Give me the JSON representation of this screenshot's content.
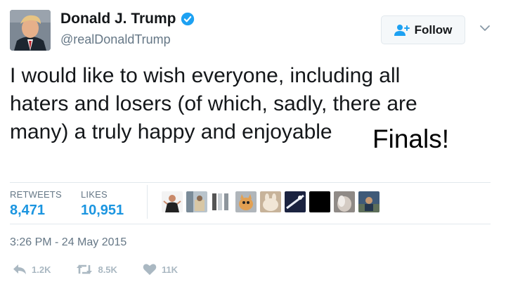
{
  "tweet": {
    "author_name": "Donald J. Trump",
    "author_handle": "@realDonaldTrump",
    "text": "I would like to wish everyone, including all haters and losers (of which, sadly, there are many) a truly happy and enjoyable",
    "overlay_text": "Finals!",
    "timestamp": "3:26 PM - 24 May 2015"
  },
  "follow_label": "Follow",
  "stats": {
    "retweets_label": "RETWEETS",
    "retweets_value": "8,471",
    "likes_label": "LIKES",
    "likes_value": "10,951"
  },
  "actions": {
    "reply_count": "1.2K",
    "retweet_count": "8.5K",
    "like_count": "11K"
  },
  "colors": {
    "link_blue": "#1b95e0",
    "muted_gray": "#657786",
    "action_gray": "#aab8c2"
  },
  "icons": [
    "verified-badge-icon",
    "follow-person-plus-icon",
    "chevron-down-icon",
    "reply-icon",
    "retweet-icon",
    "heart-icon"
  ]
}
